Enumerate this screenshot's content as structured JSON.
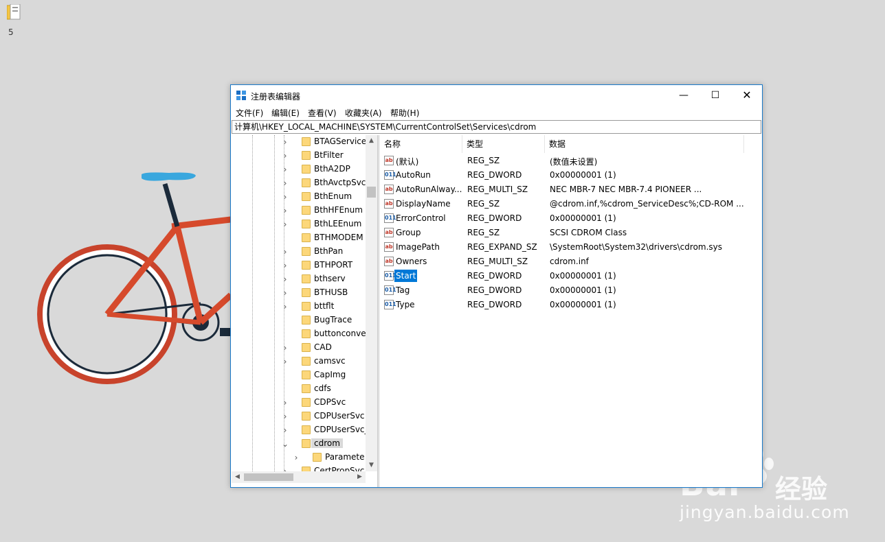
{
  "desktop": {
    "icon_label": "5"
  },
  "watermark": {
    "brand": "Bai",
    "brand_cn": "经验",
    "url": "jingyan.baidu.com"
  },
  "window": {
    "title": "注册表编辑器",
    "controls": {
      "minimize": "—",
      "maximize": "☐",
      "close": "✕"
    },
    "menu": [
      "文件(F)",
      "编辑(E)",
      "查看(V)",
      "收藏夹(A)",
      "帮助(H)"
    ],
    "address": "计算机\\HKEY_LOCAL_MACHINE\\SYSTEM\\CurrentControlSet\\Services\\cdrom",
    "tree": [
      {
        "label": "BTAGService",
        "expandable": true
      },
      {
        "label": "BtFilter",
        "expandable": true
      },
      {
        "label": "BthA2DP",
        "expandable": true
      },
      {
        "label": "BthAvctpSvc",
        "expandable": true
      },
      {
        "label": "BthEnum",
        "expandable": true
      },
      {
        "label": "BthHFEnum",
        "expandable": true
      },
      {
        "label": "BthLEEnum",
        "expandable": true
      },
      {
        "label": "BTHMODEM",
        "expandable": false
      },
      {
        "label": "BthPan",
        "expandable": true
      },
      {
        "label": "BTHPORT",
        "expandable": true
      },
      {
        "label": "bthserv",
        "expandable": true
      },
      {
        "label": "BTHUSB",
        "expandable": true
      },
      {
        "label": "bttflt",
        "expandable": true
      },
      {
        "label": "BugTrace",
        "expandable": false
      },
      {
        "label": "buttonconve",
        "expandable": false
      },
      {
        "label": "CAD",
        "expandable": true
      },
      {
        "label": "camsvc",
        "expandable": true
      },
      {
        "label": "CapImg",
        "expandable": false
      },
      {
        "label": "cdfs",
        "expandable": false
      },
      {
        "label": "CDPSvc",
        "expandable": true
      },
      {
        "label": "CDPUserSvc",
        "expandable": true
      },
      {
        "label": "CDPUserSvc_",
        "expandable": true
      },
      {
        "label": "cdrom",
        "expandable": true,
        "expanded": true,
        "selected": true
      },
      {
        "label": "Paramete",
        "expandable": true,
        "child": true
      },
      {
        "label": "CertPropSvc",
        "expandable": true
      }
    ],
    "columns": {
      "name": "名称",
      "type": "类型",
      "data": "数据"
    },
    "values": [
      {
        "icon": "ab",
        "name": "(默认)",
        "type": "REG_SZ",
        "data": "(数值未设置)"
      },
      {
        "icon": "bin",
        "name": "AutoRun",
        "type": "REG_DWORD",
        "data": "0x00000001 (1)"
      },
      {
        "icon": "ab",
        "name": "AutoRunAlway...",
        "type": "REG_MULTI_SZ",
        "data": "NEC     MBR-7    NEC     MBR-7.4  PIONEER ..."
      },
      {
        "icon": "ab",
        "name": "DisplayName",
        "type": "REG_SZ",
        "data": "@cdrom.inf,%cdrom_ServiceDesc%;CD-ROM ..."
      },
      {
        "icon": "bin",
        "name": "ErrorControl",
        "type": "REG_DWORD",
        "data": "0x00000001 (1)"
      },
      {
        "icon": "ab",
        "name": "Group",
        "type": "REG_SZ",
        "data": "SCSI CDROM Class"
      },
      {
        "icon": "ab",
        "name": "ImagePath",
        "type": "REG_EXPAND_SZ",
        "data": "\\SystemRoot\\System32\\drivers\\cdrom.sys"
      },
      {
        "icon": "ab",
        "name": "Owners",
        "type": "REG_MULTI_SZ",
        "data": "cdrom.inf"
      },
      {
        "icon": "bin",
        "name": "Start",
        "type": "REG_DWORD",
        "data": "0x00000001 (1)",
        "selected": true
      },
      {
        "icon": "bin",
        "name": "Tag",
        "type": "REG_DWORD",
        "data": "0x00000001 (1)"
      },
      {
        "icon": "bin",
        "name": "Type",
        "type": "REG_DWORD",
        "data": "0x00000001 (1)"
      }
    ],
    "colors": {
      "accent": "#0078d7",
      "folder": "#fcd77a",
      "border": "#1979ca"
    }
  }
}
